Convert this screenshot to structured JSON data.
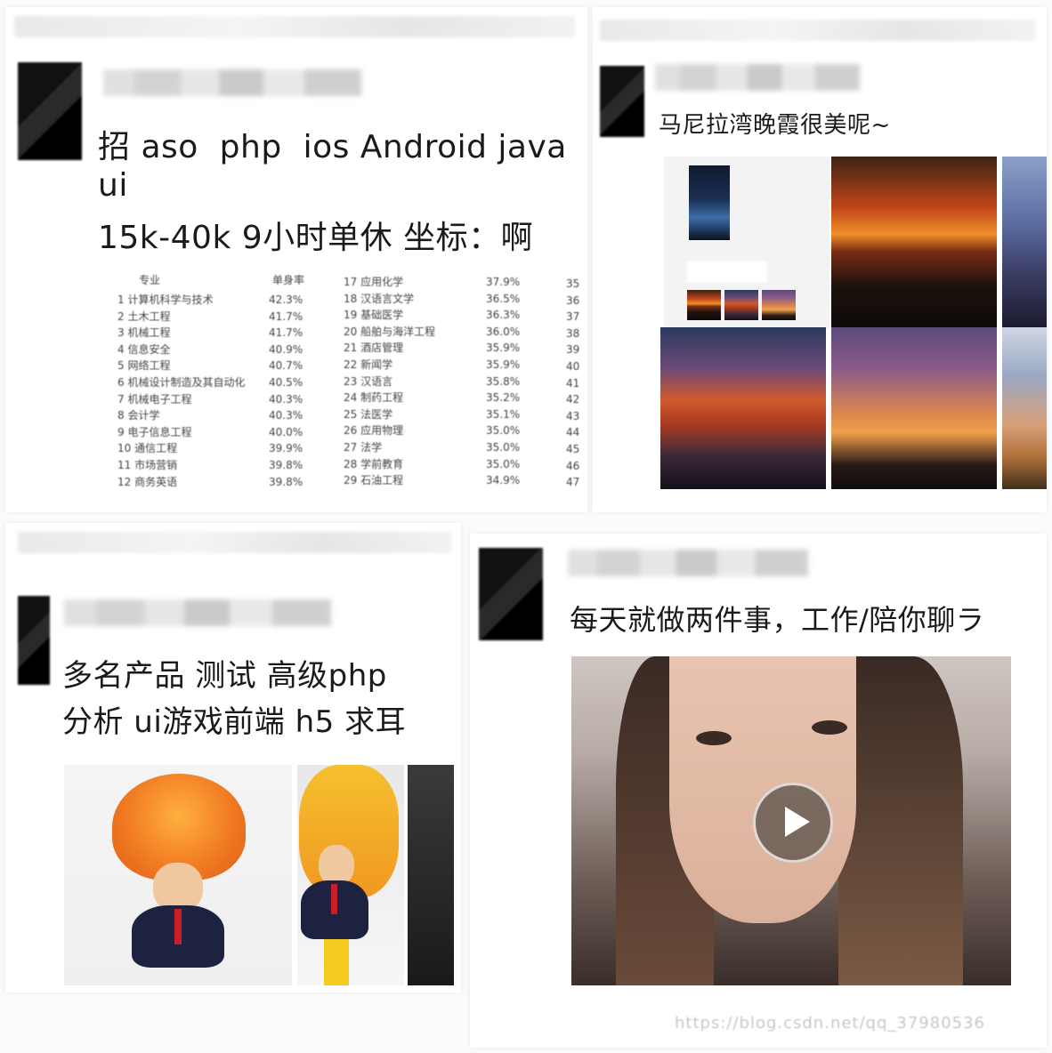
{
  "posts": [
    {
      "text_line1": "招 aso  php  ios Android java",
      "text_line2": "ui",
      "text_line3": "15k-40k 9小时单休 坐标：啊",
      "table": {
        "header_major": "专业",
        "header_rate": "单身率",
        "col1": [
          {
            "name": "1 计算机科学与技术",
            "rate": "42.3%"
          },
          {
            "name": "2 土木工程",
            "rate": "41.7%"
          },
          {
            "name": "3 机械工程",
            "rate": "41.7%"
          },
          {
            "name": "4 信息安全",
            "rate": "40.9%"
          },
          {
            "name": "5 网络工程",
            "rate": "40.7%"
          },
          {
            "name": "6 机械设计制造及其自动化",
            "rate": "40.5%"
          },
          {
            "name": "7 机械电子工程",
            "rate": "40.3%"
          },
          {
            "name": "8 会计学",
            "rate": "40.3%"
          },
          {
            "name": "9 电子信息工程",
            "rate": "40.0%"
          },
          {
            "name": "10 通信工程",
            "rate": "39.9%"
          },
          {
            "name": "11 市场营销",
            "rate": "39.8%"
          },
          {
            "name": "12 商务英语",
            "rate": "39.8%"
          }
        ],
        "col2": [
          {
            "name": "17 应用化学",
            "rate": "37.9%"
          },
          {
            "name": "18 汉语言文学",
            "rate": "36.5%"
          },
          {
            "name": "19 基础医学",
            "rate": "36.3%"
          },
          {
            "name": "20 船舶与海洋工程",
            "rate": "36.0%"
          },
          {
            "name": "21 酒店管理",
            "rate": "35.9%"
          },
          {
            "name": "22 新闻学",
            "rate": "35.9%"
          },
          {
            "name": "23 汉语言",
            "rate": "35.8%"
          },
          {
            "name": "24 制药工程",
            "rate": "35.2%"
          },
          {
            "name": "25 法医学",
            "rate": "35.1%"
          },
          {
            "name": "26 应用物理",
            "rate": "35.0%"
          },
          {
            "name": "27 法学",
            "rate": "35.0%"
          },
          {
            "name": "28 学前教育",
            "rate": "35.0%"
          },
          {
            "name": "29 石油工程",
            "rate": "34.9%"
          }
        ],
        "col3": [
          "35",
          "36",
          "37",
          "38",
          "39",
          "40",
          "41",
          "42",
          "43",
          "44",
          "45",
          "46",
          "47"
        ]
      }
    },
    {
      "text_line1": "马尼拉湾晚霞很美呢~"
    },
    {
      "text_line1": "多名产品 测试 高级php",
      "text_line2": "分析 ui游戏前端 h5 求耳"
    },
    {
      "text_line1": "每天就做两件事，工作/陪你聊ラ"
    }
  ],
  "watermark": "https://blog.csdn.net/qq_37980536",
  "colors": {
    "text": "#1a1a1a",
    "background": "#ffffff",
    "play_overlay": "#282828"
  },
  "icons": {
    "play": "play-icon"
  }
}
